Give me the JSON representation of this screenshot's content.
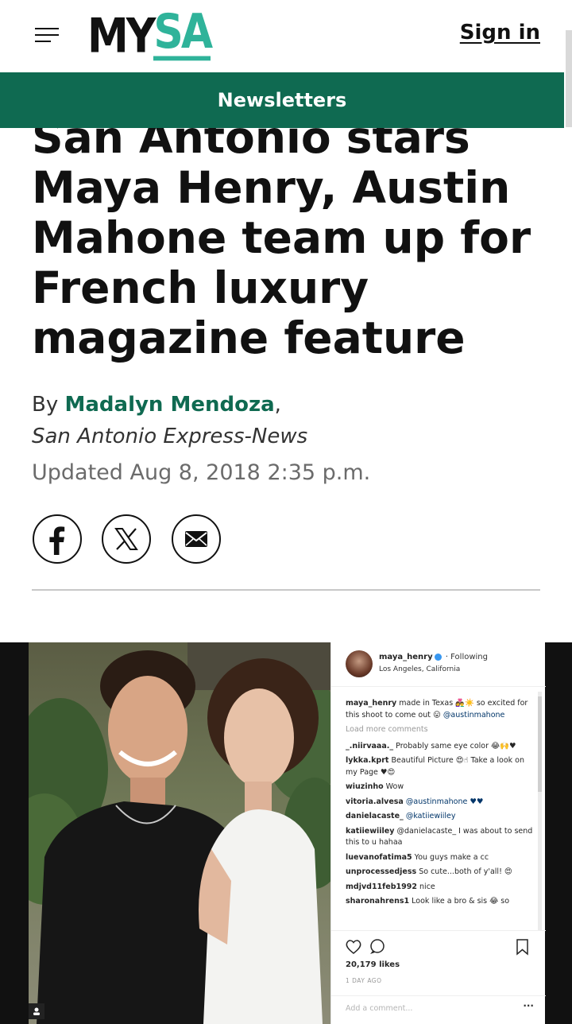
{
  "header": {
    "logo_my": "MY",
    "logo_sa": "SA",
    "sign_in_label": "Sign in"
  },
  "newsletter": {
    "label": "Newsletters"
  },
  "article": {
    "headline_line1": "San Antonio stars",
    "headline_line2": "Maya Henry, Austin",
    "headline_line3": "Mahone team up for",
    "headline_line4": "French luxury",
    "headline_line5": "magazine feature",
    "byline_prefix": "By",
    "author": "Madalyn Mendoza",
    "byline_comma": ",",
    "publication": "San Antonio Express-News",
    "updated": "Updated Aug 8, 2018 2:35 p.m."
  },
  "share": {
    "facebook_icon": "facebook-icon",
    "x_icon": "x-icon",
    "email_icon": "email-icon"
  },
  "instagram": {
    "username": "maya_henry",
    "following": "Following",
    "location": "Los Angeles, California",
    "caption_user": "maya_henry",
    "caption_text": "made in Texas 👩‍❤️‍👨☀️ so excited for this shoot to come out 😛",
    "caption_mention": "@austinmahone",
    "load_more": "Load more comments",
    "comments": [
      {
        "user": "_.niirvaaa._",
        "text": "Probably same eye color 😂🙌♥"
      },
      {
        "user": "lykka.kprt",
        "text": "Beautiful Picture 😍☝ Take a look on my Page ♥😍"
      },
      {
        "user": "wiuzinho",
        "text": "Wow"
      },
      {
        "user": "vitoria.alvesa",
        "text": "@austinmahone ♥♥"
      },
      {
        "user": "danielacaste_",
        "text": "@katiiewiiley"
      },
      {
        "user": "katiiewiiley",
        "text": "@danielacaste_ I was about to send this to u hahaa"
      },
      {
        "user": "luevanofatima5",
        "text": "You guys make a cc"
      },
      {
        "user": "unprocessedjess",
        "text": "So cute...both of y'all! 😍"
      },
      {
        "user": "mdjvd11feb1992",
        "text": "nice"
      },
      {
        "user": "sharonahrens1",
        "text": "Look like a bro & sis 😂 so"
      }
    ],
    "likes": "20,179 likes",
    "time_ago": "1 DAY AGO",
    "add_comment": "Add a comment...",
    "more": "···"
  }
}
